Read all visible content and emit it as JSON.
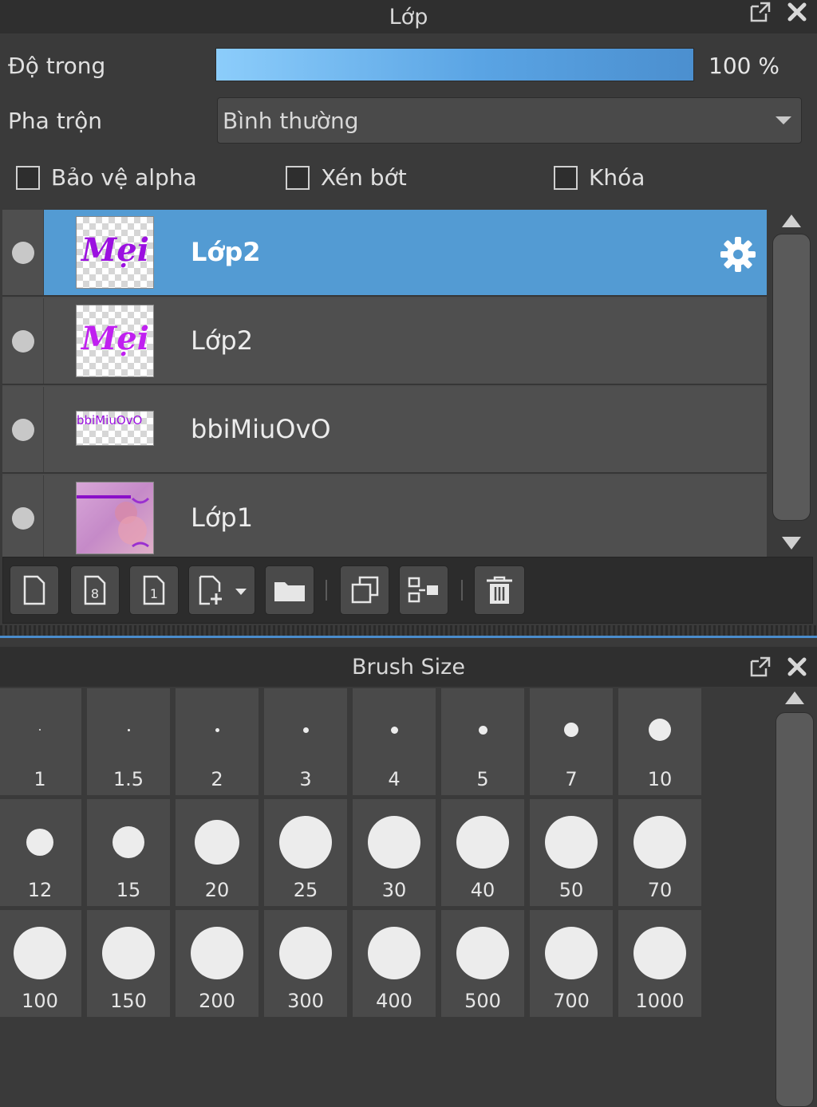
{
  "layers_panel": {
    "title": "Lớp",
    "opacity_label": "Độ trong",
    "opacity_value": "100 %",
    "opacity_fraction": 1.0,
    "blend_label": "Pha trộn",
    "blend_value": "Bình thường",
    "checkboxes": [
      {
        "label": "Bảo vệ alpha",
        "checked": false
      },
      {
        "label": "Xén bớt",
        "checked": false
      },
      {
        "label": "Khóa",
        "checked": false
      }
    ],
    "layers": [
      {
        "name": "Lớp2",
        "selected": true,
        "thumb_text": "Mẹi"
      },
      {
        "name": "Lớp2",
        "selected": false,
        "thumb_text": "Mẹi"
      },
      {
        "name": "bbiMiuOvO",
        "selected": false,
        "thumb_text": "bbiMiuOvO"
      },
      {
        "name": "Lớp1",
        "selected": false,
        "thumb_text": ""
      }
    ],
    "accent_color": "#539bd3"
  },
  "brush_panel": {
    "title": "Brush Size",
    "sizes": [
      "1",
      "1.5",
      "2",
      "3",
      "4",
      "5",
      "7",
      "10",
      "12",
      "15",
      "20",
      "25",
      "30",
      "40",
      "50",
      "70",
      "100",
      "150",
      "200",
      "300",
      "400",
      "500",
      "700",
      "1000"
    ]
  }
}
